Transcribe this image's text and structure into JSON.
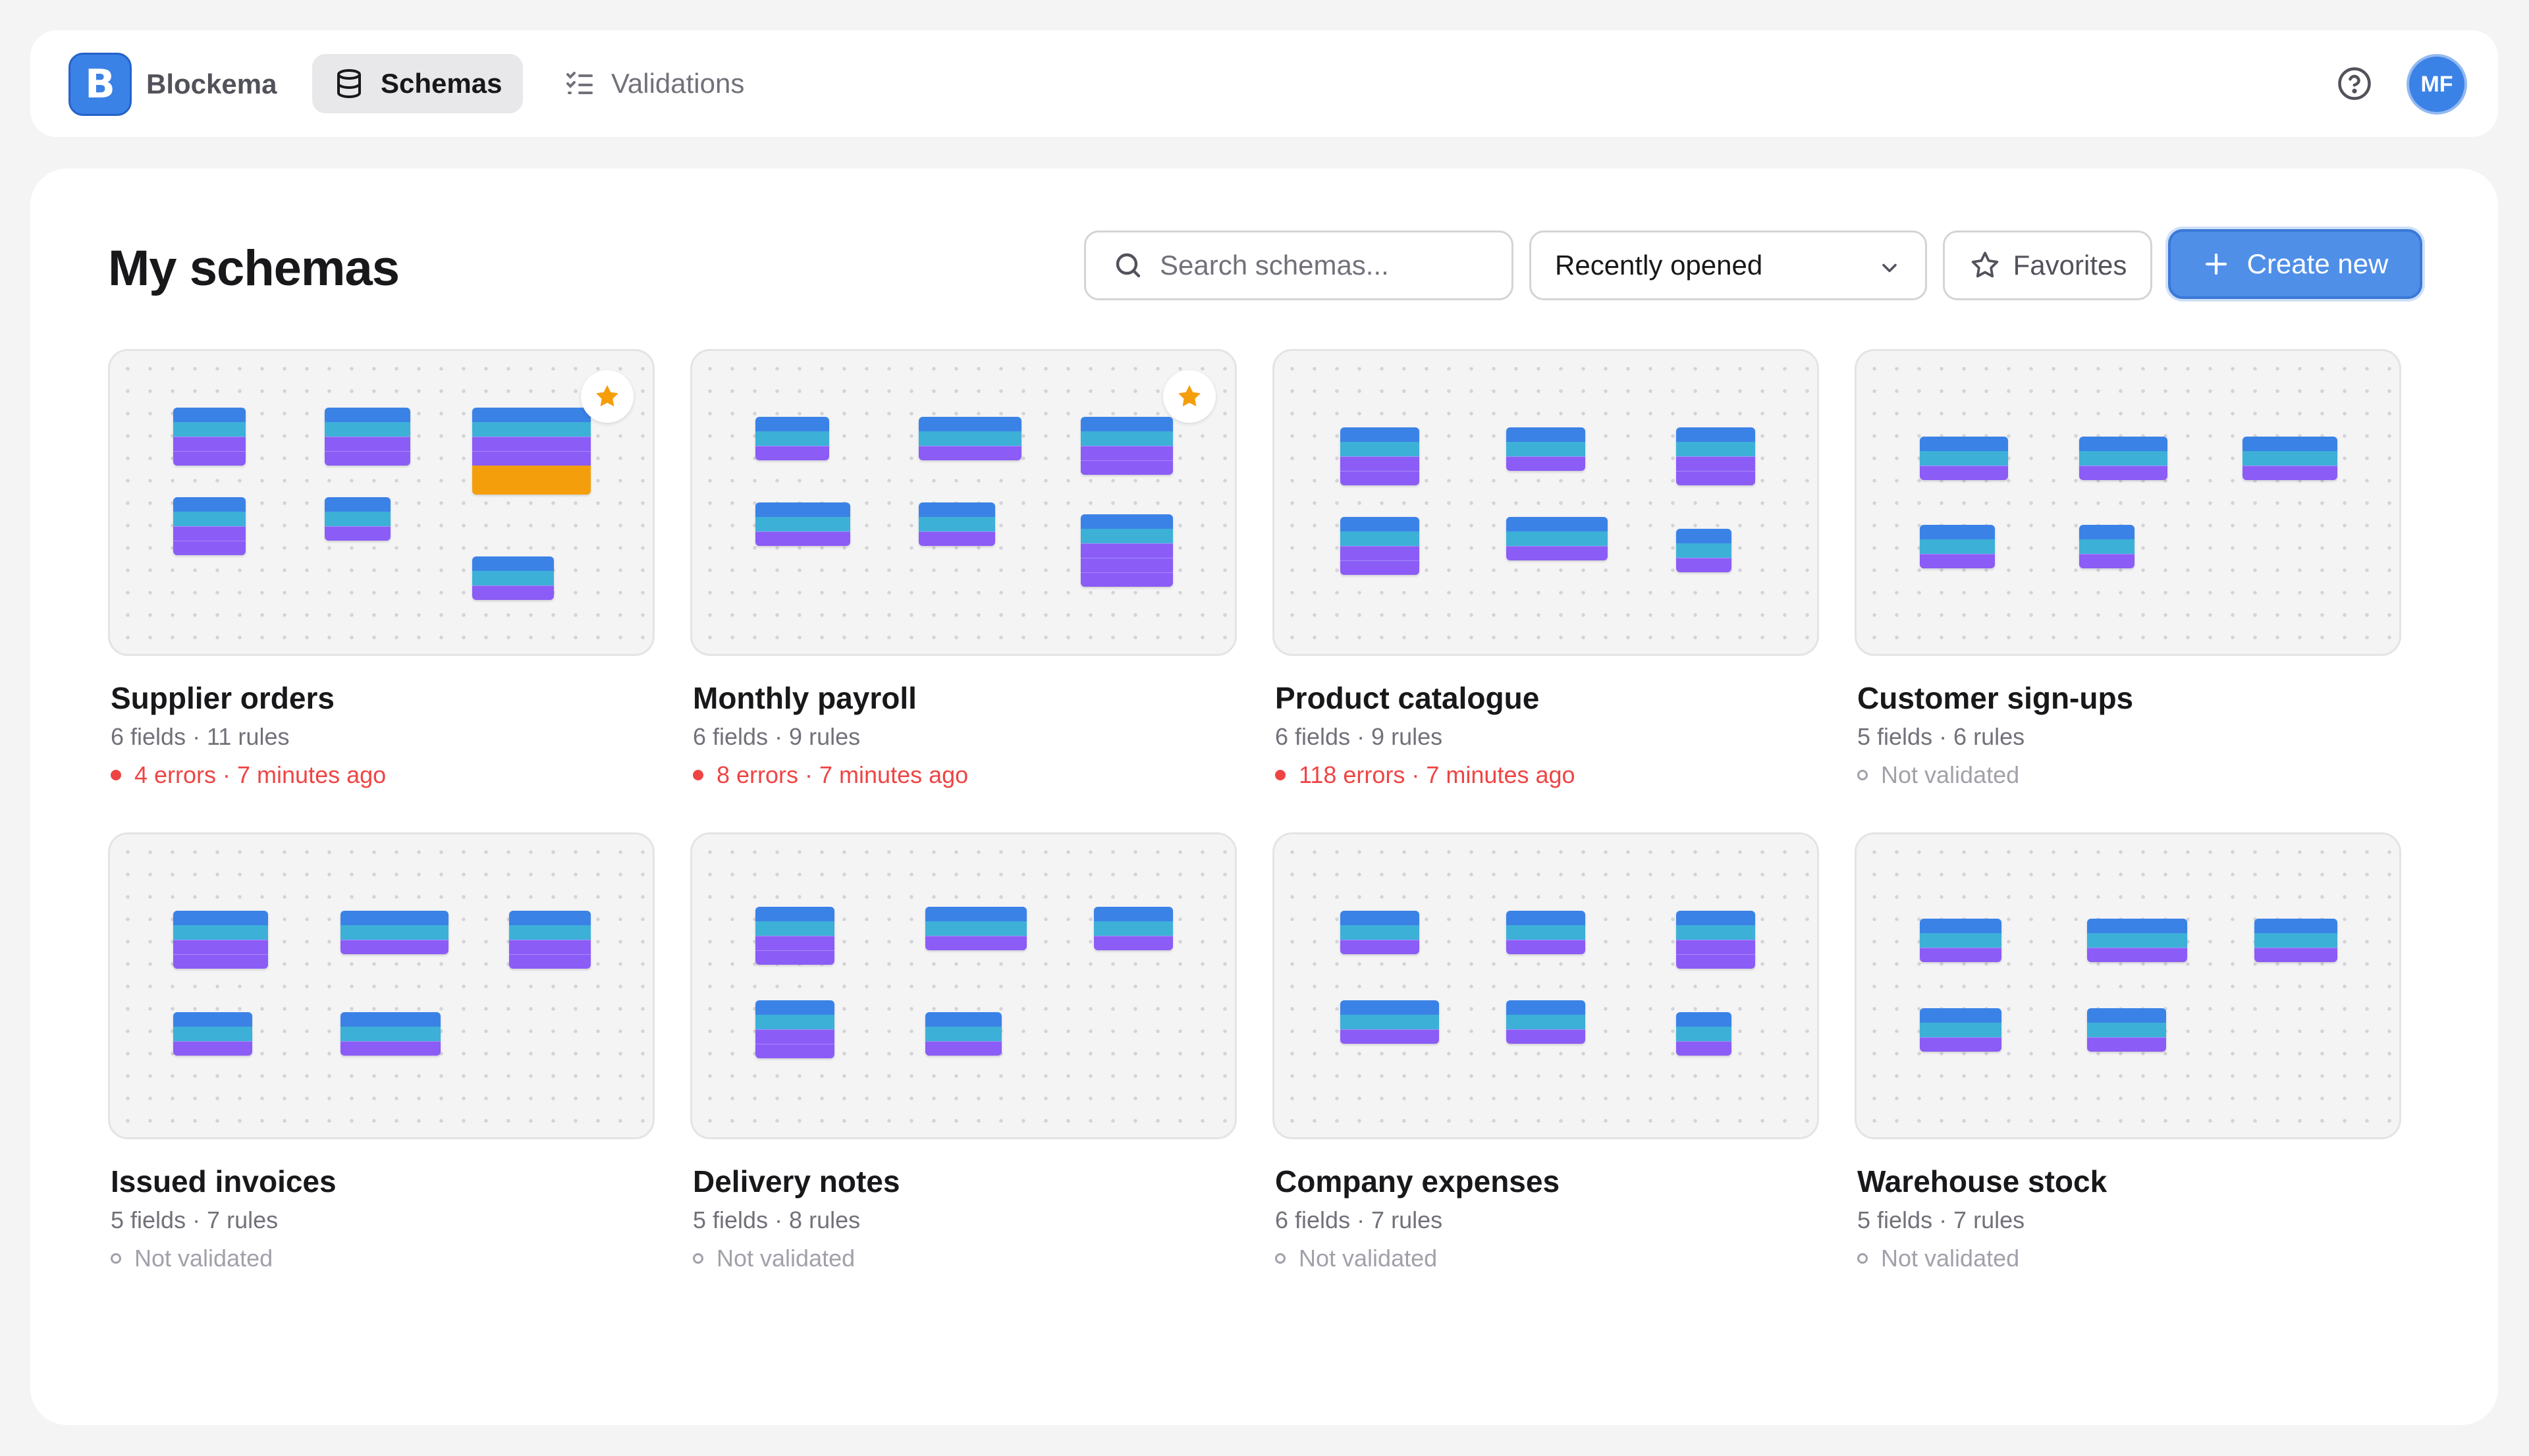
{
  "app": {
    "brand_letter": "B",
    "brand_name": "Blockema",
    "nav": [
      {
        "label": "Schemas",
        "icon": "database-icon",
        "active": true
      },
      {
        "label": "Validations",
        "icon": "checklist-icon",
        "active": false
      }
    ],
    "user_initials": "MF"
  },
  "page": {
    "title": "My schemas",
    "search_placeholder": "Search schemas...",
    "sort_selected": "Recently opened",
    "favorites_label": "Favorites",
    "create_label": "Create new"
  },
  "schemas": [
    {
      "name": "Supplier orders",
      "meta": "6 fields · 11 rules",
      "status": "4 errors · 7 minutes ago",
      "status_kind": "error",
      "favorite": true
    },
    {
      "name": "Monthly payroll",
      "meta": "6 fields · 9 rules",
      "status": "8 errors · 7 minutes ago",
      "status_kind": "error",
      "favorite": true
    },
    {
      "name": "Product catalogue",
      "meta": "6 fields · 9 rules",
      "status": "118 errors · 7 minutes ago",
      "status_kind": "error",
      "favorite": false
    },
    {
      "name": "Customer sign-ups",
      "meta": "5 fields · 6 rules",
      "status": "Not validated",
      "status_kind": "none",
      "favorite": false
    },
    {
      "name": "Issued invoices",
      "meta": "5 fields · 7 rules",
      "status": "Not validated",
      "status_kind": "none",
      "favorite": false
    },
    {
      "name": "Delivery notes",
      "meta": "5 fields · 8 rules",
      "status": "Not validated",
      "status_kind": "none",
      "favorite": false
    },
    {
      "name": "Company expenses",
      "meta": "6 fields · 7 rules",
      "status": "Not validated",
      "status_kind": "none",
      "favorite": false
    },
    {
      "name": "Warehouse stock",
      "meta": "5 fields · 7 rules",
      "status": "Not validated",
      "status_kind": "none",
      "favorite": false
    }
  ],
  "colors": {
    "accent": "#3b82e6",
    "error": "#ef4444",
    "favorite_star": "#f59e0b"
  }
}
